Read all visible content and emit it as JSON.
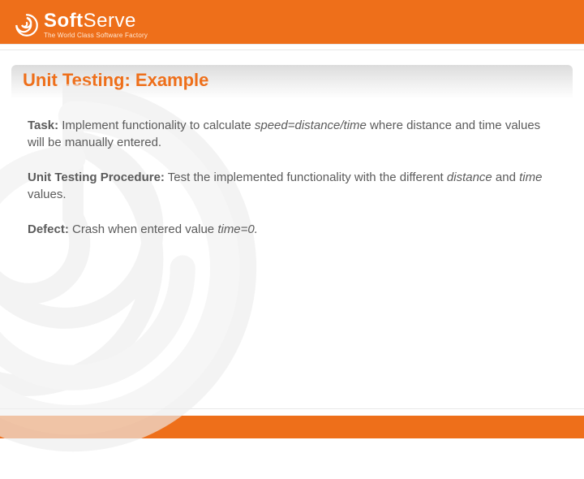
{
  "brand": {
    "name_a": "Soft",
    "name_b": "Serve",
    "tagline": "The World Class Software Factory"
  },
  "slide": {
    "title": "Unit Testing: Example",
    "task_label": "Task:",
    "task_text_a": " Implement functionality to calculate ",
    "task_formula": "speed=distance/time",
    "task_text_b": " where distance and time values will be manually entered.",
    "procedure_label": "Unit Testing Procedure:",
    "procedure_text_a": " Test the implemented functionality with the different ",
    "procedure_em1": "distance",
    "procedure_text_b": " and ",
    "procedure_em2": "time",
    "procedure_text_c": " values.",
    "defect_label": "Defect:",
    "defect_text_a": " Crash when entered value ",
    "defect_em": "time=0."
  }
}
